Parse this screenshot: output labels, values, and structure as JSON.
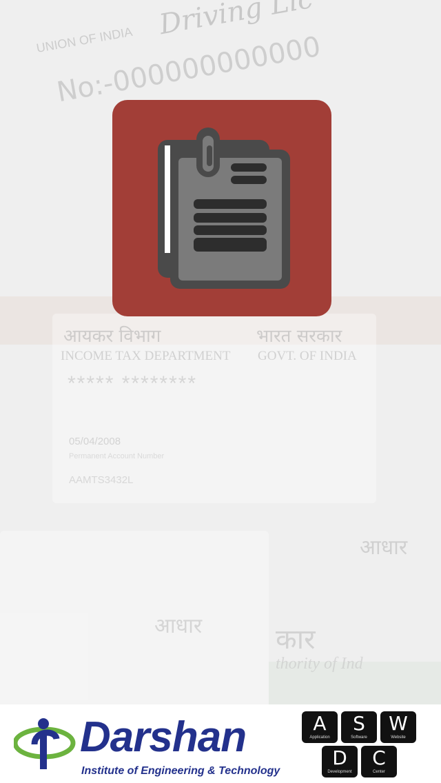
{
  "background": {
    "driving_licence_title": "Driving Lic",
    "driving_licence_sub": "UNION OF INDIA",
    "driving_licence_no": "No:-000000000000",
    "pan_hindi_left": "आयकर विभाग",
    "pan_hindi_right": "भारत सरकार",
    "pan_english_left": "INCOME TAX DEPARTMENT",
    "pan_english_right": "GOVT. OF INDIA",
    "pan_masked_name": "***** ********",
    "pan_date": "05/04/2008",
    "pan_number_label": "Permanent Account Number",
    "pan_number": "AAMTS3432L",
    "aadhaar_1": "आधार",
    "aadhaar_2": "आधार",
    "govt_fragment": "कार",
    "authority_fragment": "thority of Ind"
  },
  "app_icon": {
    "name": "documents-icon",
    "background_color": "#a23e37"
  },
  "footer": {
    "darshan_name": "Darshan",
    "darshan_subtitle": "Institute of Engineering & Technology",
    "aswdc_keys": [
      {
        "letter": "A",
        "word": "Application"
      },
      {
        "letter": "S",
        "word": "Software"
      },
      {
        "letter": "W",
        "word": "Website"
      },
      {
        "letter": "D",
        "word": "Development"
      },
      {
        "letter": "C",
        "word": "Center"
      }
    ],
    "brand_color": "#23318c"
  }
}
